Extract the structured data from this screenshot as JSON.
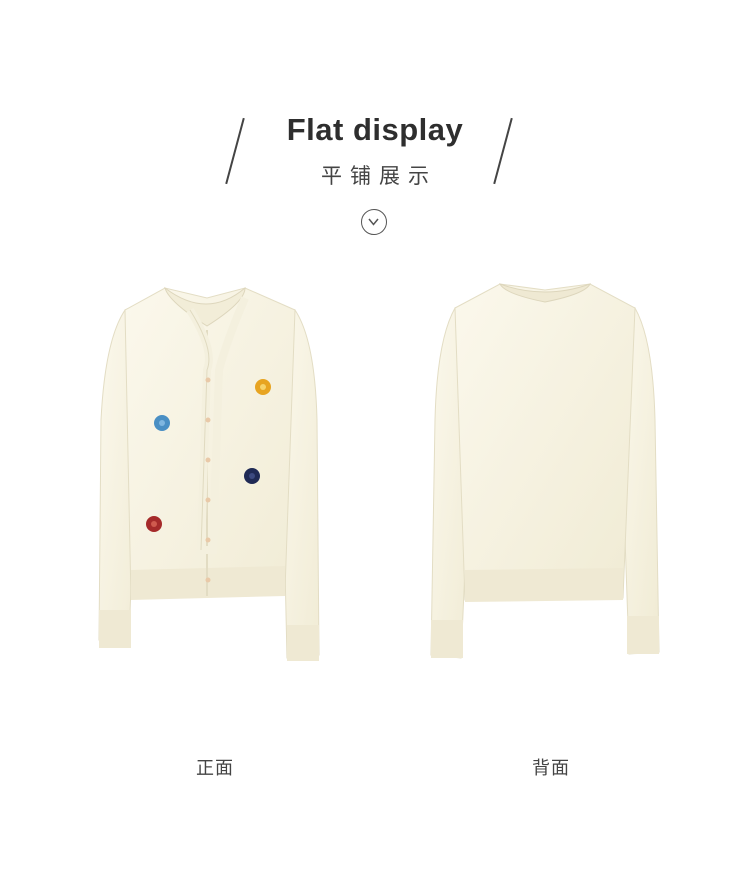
{
  "header": {
    "title_en": "Flat display",
    "title_cn": "平铺展示"
  },
  "icons": {
    "scroll_indicator": "chevron-down-circle-icon"
  },
  "items": [
    {
      "caption": "正面",
      "image": "cardigan-front-view",
      "flowers": [
        "#e7a421",
        "#4a8fc4",
        "#1f2a55",
        "#a52a2a"
      ]
    },
    {
      "caption": "背面",
      "image": "cardigan-back-view"
    }
  ],
  "colors": {
    "garment": "#f7f3e3",
    "garment_shadow": "#e6e0c8",
    "text": "#333333"
  }
}
